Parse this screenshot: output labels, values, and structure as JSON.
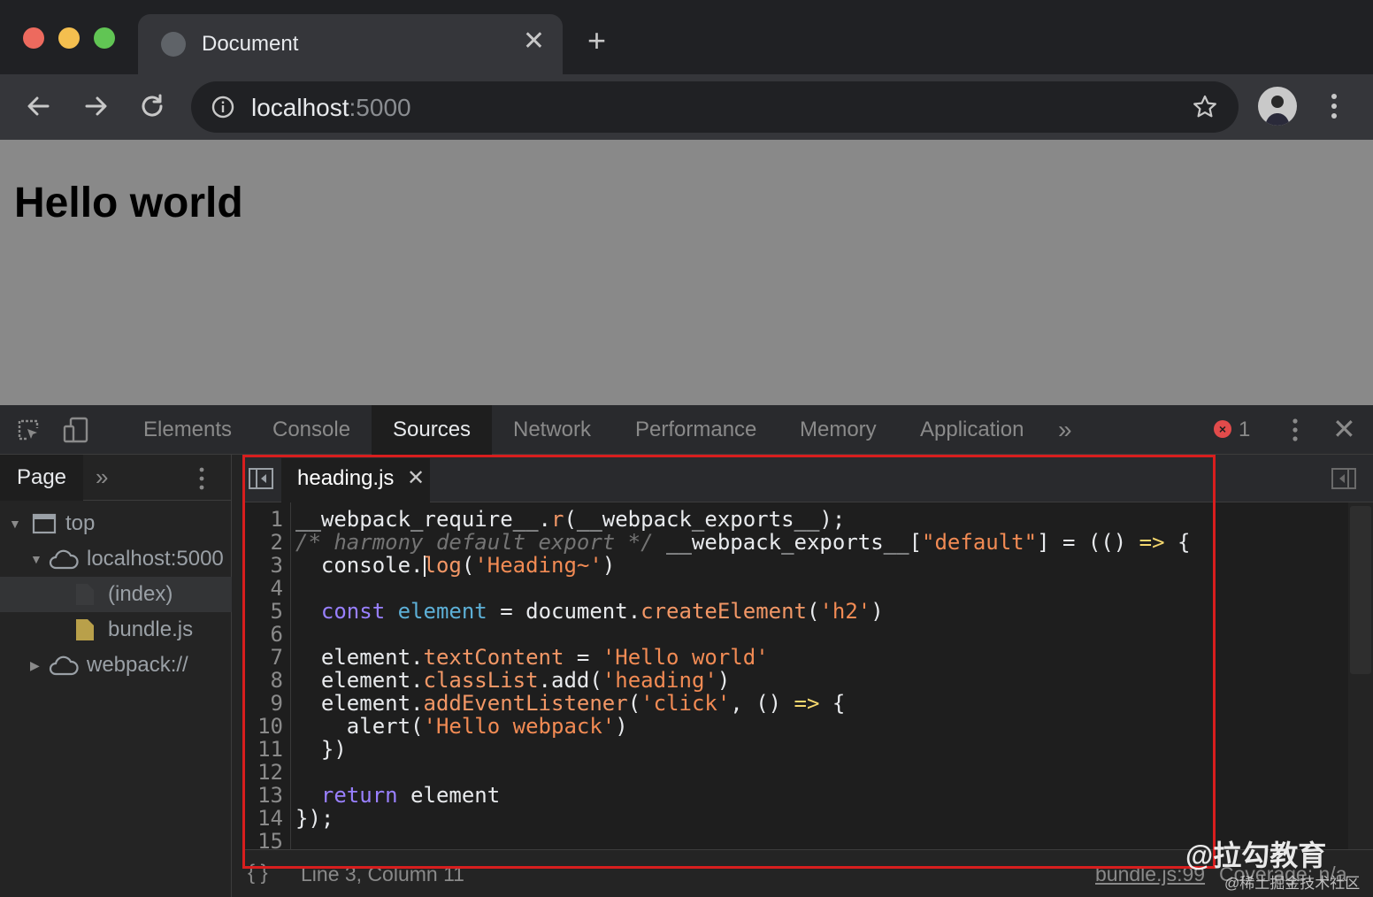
{
  "browser": {
    "tab_title": "Document",
    "tab_close": "✕",
    "new_tab": "+",
    "url_host": "localhost",
    "url_port": ":5000"
  },
  "page": {
    "heading": "Hello world"
  },
  "devtools": {
    "tabs": [
      "Elements",
      "Console",
      "Sources",
      "Network",
      "Performance",
      "Memory",
      "Application"
    ],
    "active_tab": "Sources",
    "more_tabs": "»",
    "error_count": "1",
    "close": "✕"
  },
  "navigator": {
    "tab_label": "Page",
    "more": "»",
    "tree": [
      {
        "label": "top",
        "expanded": true
      },
      {
        "label": "localhost:5000",
        "expanded": true
      },
      {
        "label": "(index)",
        "selected": true
      },
      {
        "label": "bundle.js"
      },
      {
        "label": "webpack://",
        "expanded": false
      }
    ]
  },
  "editor": {
    "file_tab": "heading.js",
    "file_tab_close": "✕",
    "line_numbers": [
      "1",
      "2",
      "3",
      "4",
      "5",
      "6",
      "7",
      "8",
      "9",
      "10",
      "11",
      "12",
      "13",
      "14",
      "15"
    ],
    "lines": [
      [
        {
          "t": "__webpack_require__.",
          "c": ""
        },
        {
          "t": "r",
          "c": "p"
        },
        {
          "t": "(__webpack_exports__);",
          "c": ""
        }
      ],
      [
        {
          "t": "/* harmony default export */",
          "c": "c"
        },
        {
          "t": " __webpack_exports__[",
          "c": ""
        },
        {
          "t": "\"default\"",
          "c": "s"
        },
        {
          "t": "] = (() ",
          "c": ""
        },
        {
          "t": "=>",
          "c": "ar"
        },
        {
          "t": " {",
          "c": ""
        }
      ],
      [
        {
          "t": "  console.",
          "c": ""
        },
        {
          "t": "|",
          "c": "cursor"
        },
        {
          "t": "log",
          "c": "p"
        },
        {
          "t": "(",
          "c": ""
        },
        {
          "t": "'Heading~'",
          "c": "s"
        },
        {
          "t": ")",
          "c": ""
        }
      ],
      [],
      [
        {
          "t": "  ",
          "c": ""
        },
        {
          "t": "const",
          "c": "k"
        },
        {
          "t": " ",
          "c": ""
        },
        {
          "t": "element",
          "c": "v"
        },
        {
          "t": " = document.",
          "c": ""
        },
        {
          "t": "createElement",
          "c": "p"
        },
        {
          "t": "(",
          "c": ""
        },
        {
          "t": "'h2'",
          "c": "s"
        },
        {
          "t": ")",
          "c": ""
        }
      ],
      [],
      [
        {
          "t": "  element.",
          "c": ""
        },
        {
          "t": "textContent",
          "c": "p"
        },
        {
          "t": " = ",
          "c": ""
        },
        {
          "t": "'Hello world'",
          "c": "s"
        }
      ],
      [
        {
          "t": "  element.",
          "c": ""
        },
        {
          "t": "classList",
          "c": "p"
        },
        {
          "t": ".add(",
          "c": ""
        },
        {
          "t": "'heading'",
          "c": "s"
        },
        {
          "t": ")",
          "c": ""
        }
      ],
      [
        {
          "t": "  element.",
          "c": ""
        },
        {
          "t": "addEventListener",
          "c": "p"
        },
        {
          "t": "(",
          "c": ""
        },
        {
          "t": "'click'",
          "c": "s"
        },
        {
          "t": ", () ",
          "c": ""
        },
        {
          "t": "=>",
          "c": "ar"
        },
        {
          "t": " {",
          "c": ""
        }
      ],
      [
        {
          "t": "    alert(",
          "c": ""
        },
        {
          "t": "'Hello webpack'",
          "c": "s"
        },
        {
          "t": ")",
          "c": ""
        }
      ],
      [
        {
          "t": "  })",
          "c": ""
        }
      ],
      [],
      [
        {
          "t": "  ",
          "c": ""
        },
        {
          "t": "return",
          "c": "k"
        },
        {
          "t": " element",
          "c": ""
        }
      ],
      [
        {
          "t": "});",
          "c": ""
        }
      ],
      []
    ]
  },
  "status": {
    "pretty_print": "{ }",
    "cursor_position": "Line 3, Column 11",
    "source_link": "bundle.js:99",
    "coverage": "Coverage: n/a"
  },
  "watermark": {
    "main": "@拉勾教育",
    "sub": "@稀土掘金技术社区"
  },
  "colors": {
    "highlight_box": "#d81e1e",
    "keyword": "#9980ff",
    "property": "#f29766",
    "string": "#f28b54",
    "comment": "#747474"
  }
}
